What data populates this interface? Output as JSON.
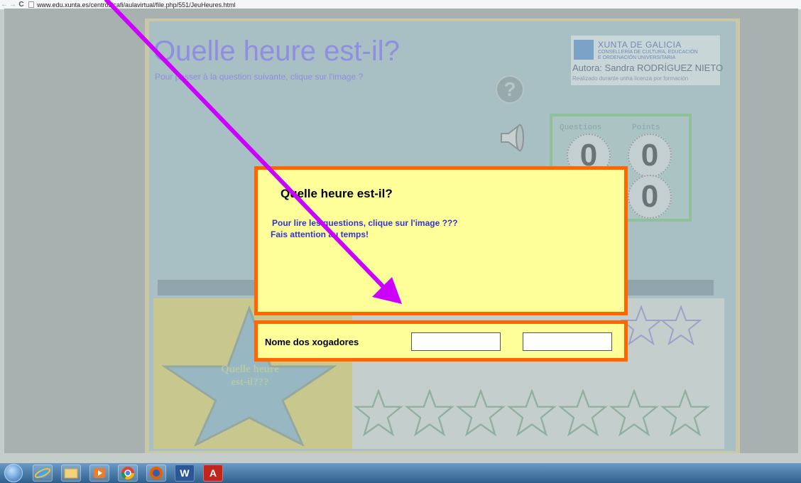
{
  "browser": {
    "back_glyph": "←",
    "forward_glyph": "→",
    "reload_glyph": "C",
    "url": "www.edu.xunta.es/centros/cafi/aulavirtual/file.php/551/JeuHeures.html"
  },
  "game": {
    "title": "Quelle heure est-il?",
    "subtitle": "Pour passer à la question suivante, clique sur l'image ?",
    "help_glyph": "?",
    "star_text_line1": "Quelle heure",
    "star_text_line2": "est-il???"
  },
  "logo": {
    "line1": "XUNTA DE GALICIA",
    "line2": "CONSELLERÍA DE CULTURA, EDUCACIÓN",
    "line3": "E ORDENACIÓN UNIVERSITARIA",
    "author": "Autora: Sandra RODRÍGUEZ NIETO",
    "note": "Realizado durante unha licenza por formación"
  },
  "score": {
    "questions_label": "Questions",
    "points_label": "Points",
    "questions_value": "0",
    "points_value": "0",
    "second_value": "0"
  },
  "dialog": {
    "title": "Quelle heure est-il?",
    "line1": "Pour lire les questions, clique sur l'image ???",
    "line2": "Fais attention au temps!"
  },
  "players": {
    "label": "Nome dos xogadores",
    "player1_value": "",
    "player2_value": ""
  },
  "colors": {
    "annotation_arrow": "#cc00ff",
    "dialog_border": "#ff6600",
    "dialog_bg": "#ffff99",
    "dialog_text": "#3333cc"
  },
  "taskbar": {
    "icons": [
      "start-orb",
      "internet-explorer-icon",
      "file-explorer-icon",
      "media-player-icon",
      "chrome-icon",
      "firefox-icon",
      "word-icon",
      "acrobat-icon"
    ],
    "word_glyph": "W",
    "acrobat_glyph": "A"
  }
}
